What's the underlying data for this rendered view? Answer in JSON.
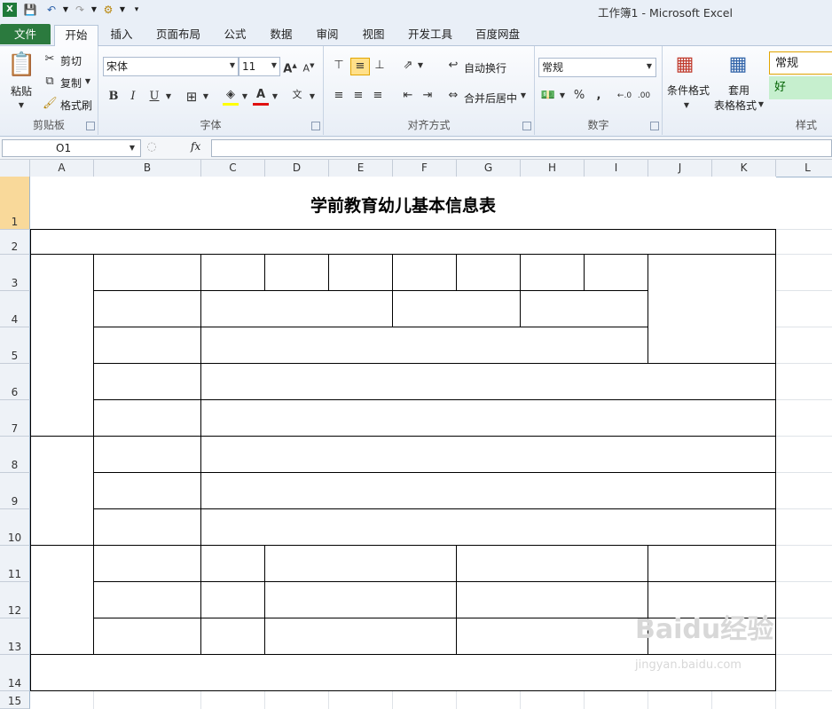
{
  "window": {
    "title": "工作簿1 - Microsoft Excel"
  },
  "tabs": [
    "文件",
    "开始",
    "插入",
    "页面布局",
    "公式",
    "数据",
    "审阅",
    "视图",
    "开发工具",
    "百度网盘"
  ],
  "ribbon": {
    "clipboard": {
      "paste": "粘贴",
      "cut": "剪切",
      "copy": "复制",
      "format_painter": "格式刷",
      "label": "剪贴板"
    },
    "font": {
      "name": "宋体",
      "size": "11",
      "label": "字体",
      "bold": "B",
      "italic": "I",
      "underline": "U"
    },
    "alignment": {
      "wrap": "自动换行",
      "merge": "合并后居中",
      "label": "对齐方式"
    },
    "number": {
      "format": "常规",
      "percent": "%",
      "comma": ",",
      "label": "数字"
    },
    "styles": {
      "conditional": "条件格式",
      "table_fmt_1": "套用",
      "table_fmt_2": "表格格式",
      "normal": "常规",
      "good": "好",
      "label": "样式"
    }
  },
  "formula_bar": {
    "name_box": "O1",
    "fx": "fx",
    "content": ""
  },
  "columns": [
    "A",
    "B",
    "C",
    "D",
    "E",
    "F",
    "G",
    "H",
    "I",
    "J",
    "K",
    "L"
  ],
  "rows": [
    "1",
    "2",
    "3",
    "4",
    "5",
    "6",
    "7",
    "8",
    "9",
    "10",
    "11",
    "12",
    "13",
    "14",
    "15"
  ],
  "sheet": {
    "title": "学前教育幼儿基本信息表"
  },
  "watermark": {
    "line1": "Baidu经验",
    "line2": "jingyan.baidu.com"
  }
}
